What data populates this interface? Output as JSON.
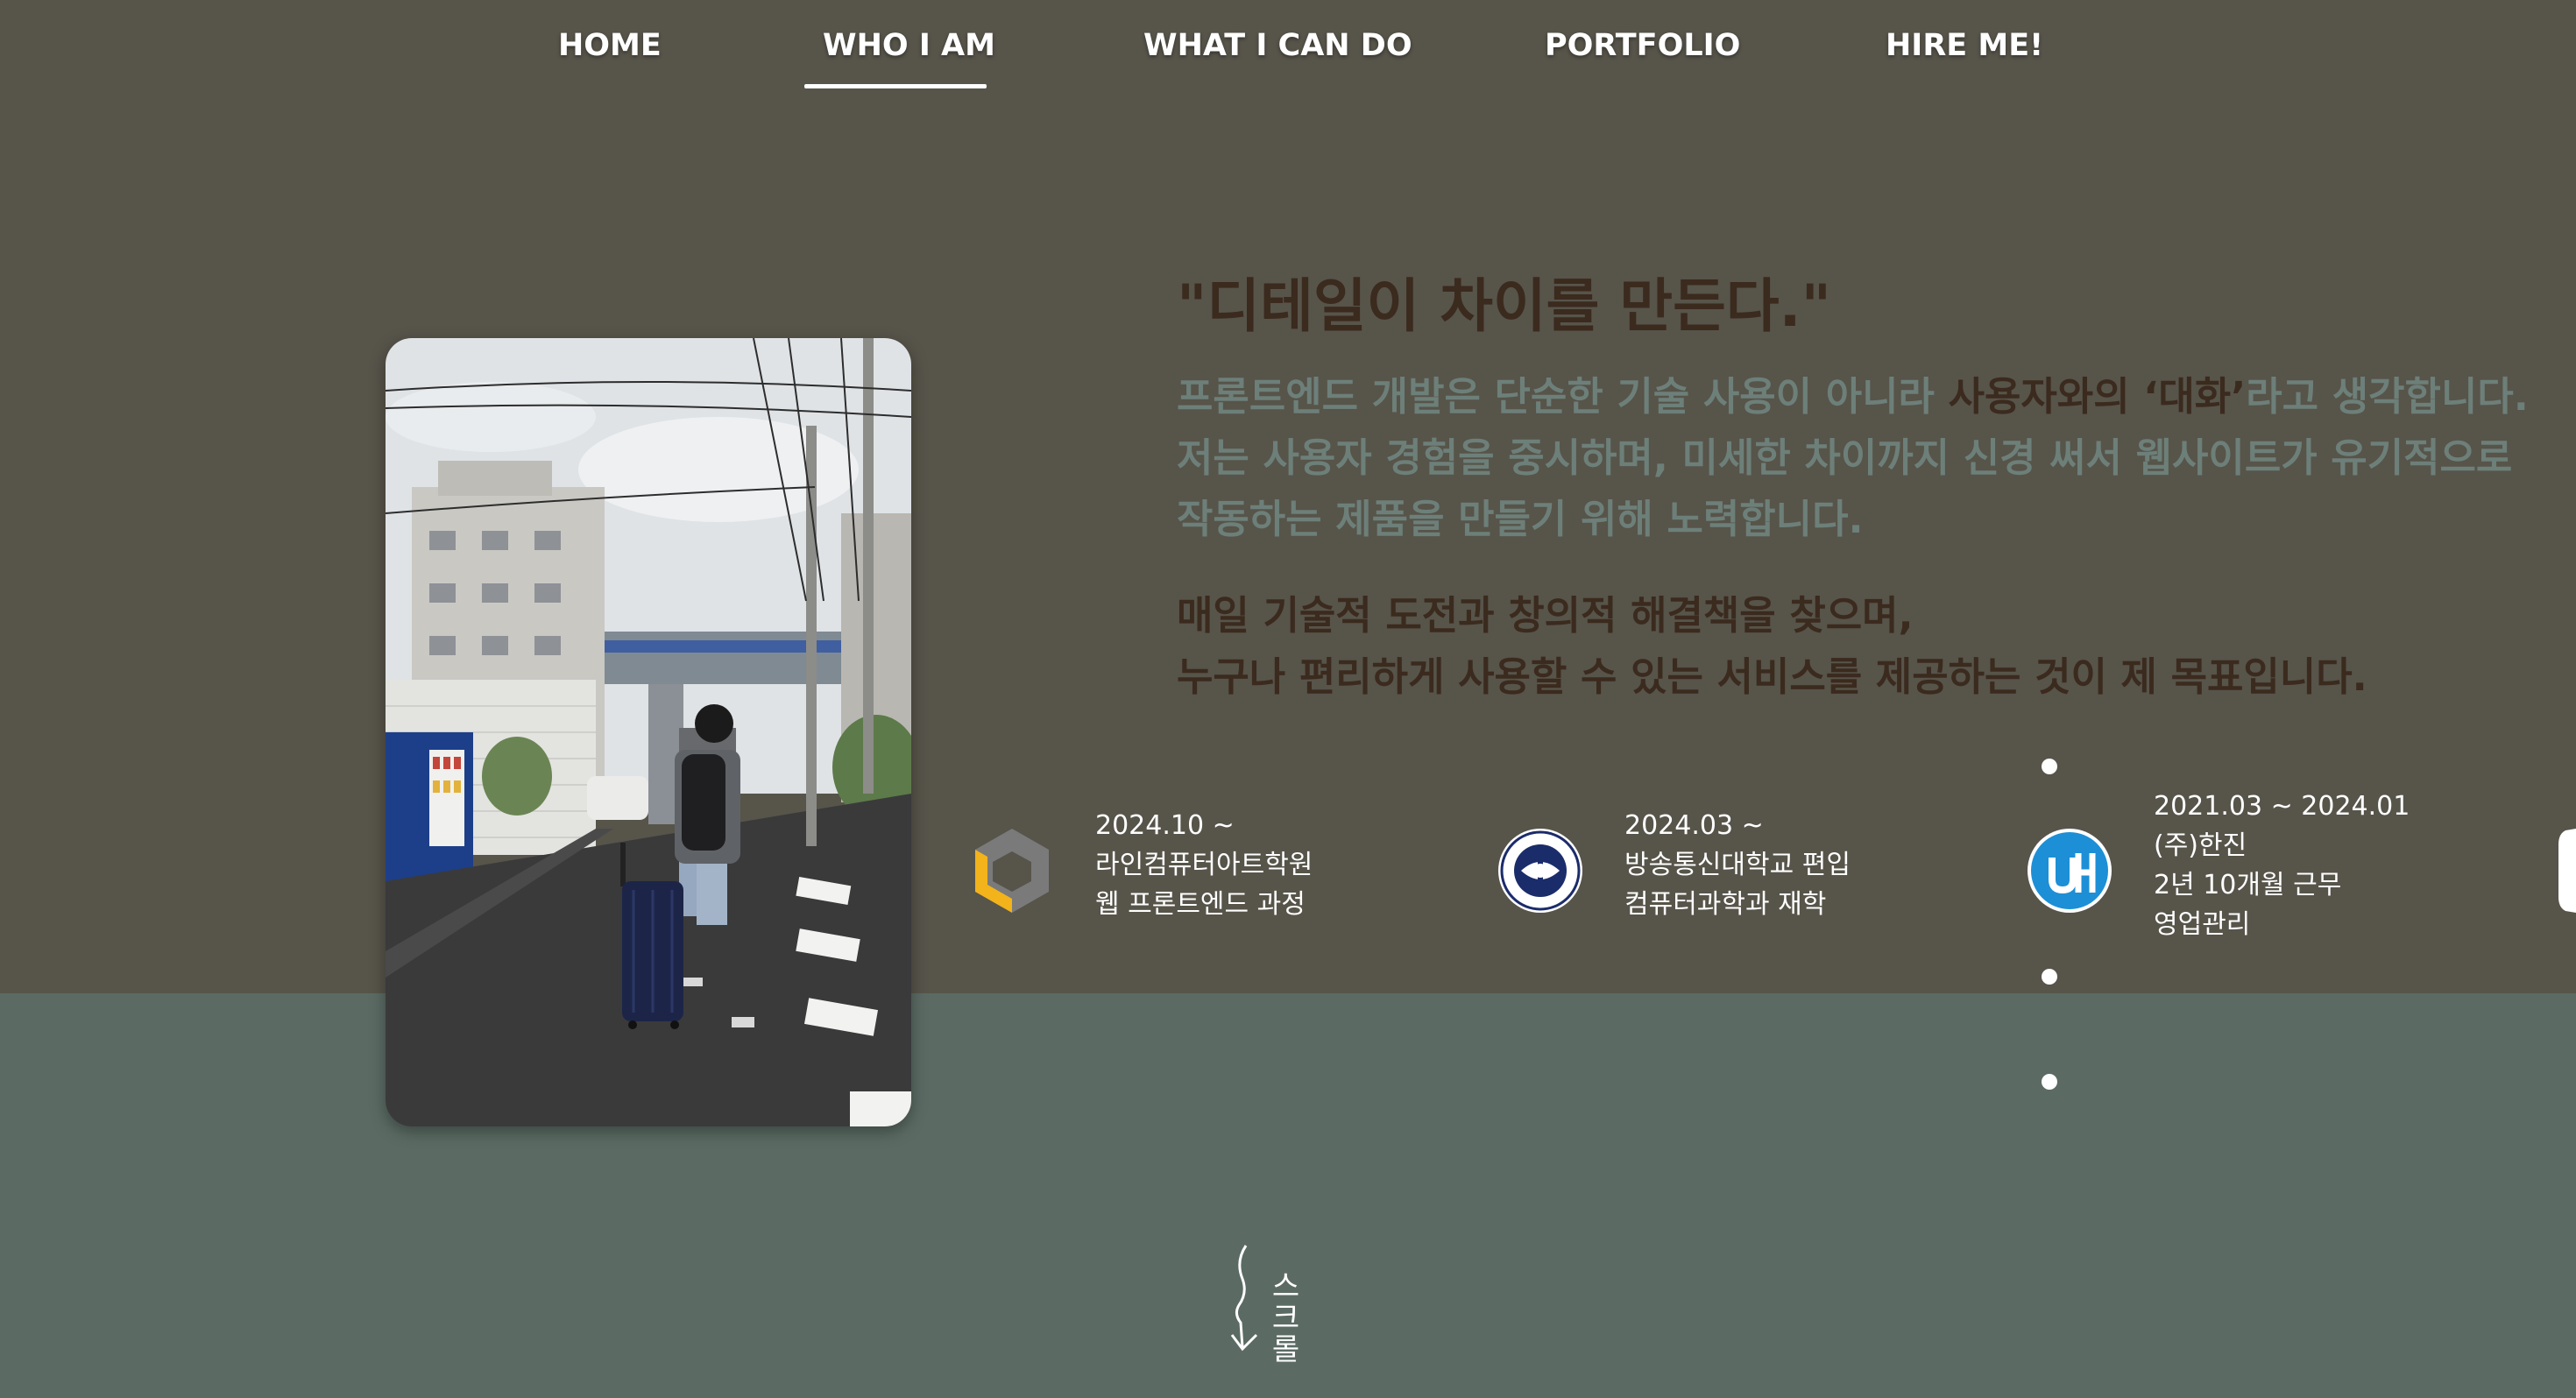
{
  "nav": {
    "items": [
      {
        "label": "HOME"
      },
      {
        "label": "WHO I AM",
        "active": true
      },
      {
        "label": "WHAT I CAN DO"
      },
      {
        "label": "PORTFOLIO"
      },
      {
        "label": "HIRE ME!"
      }
    ]
  },
  "intro": {
    "quote": "\"디테일이 차이를 만든다.\"",
    "para1_a": "프론트엔드 개발은 단순한 기술 사용이 아니라 ",
    "para1_highlight": "사용자와의 ‘대화’",
    "para1_b": "라고 생각합니다. 저는 사용자 경험을 중시하며, 미세한 차이까지 신경 써서 웹사이트가 유기적으로 작동하는 제품을 만들기 위해 노력합니다.",
    "para2_line1": "매일 기술적 도전과 창의적 해결책을 찾으며,",
    "para2_line2": "누구나 편리하게 사용할 수 있는 서비스를 제공하는 것이 제 목표입니다."
  },
  "timeline": [
    {
      "date": "2024.10 ~",
      "line1": "라인컴퓨터아트학원",
      "line2": "웹 프론트엔드 과정",
      "icon": "hexagon-academy-logo"
    },
    {
      "date": "2024.03 ~",
      "line1": "방송통신대학교 편입",
      "line2": "컴퓨터과학과 재학",
      "icon": "university-seal-logo"
    },
    {
      "date": "2021.03 ~ 2024.01",
      "line1": "(주)한진",
      "line2": "2년 10개월 근무",
      "line3": "영업관리",
      "icon": "hanjin-logo"
    }
  ],
  "scroll_hint": {
    "label": "스크롤"
  },
  "colors": {
    "top_band": "#57544a",
    "bottom_band": "#5b6b64",
    "accent_text": "#3b2a1e",
    "muted_text": "#6d7f79"
  }
}
